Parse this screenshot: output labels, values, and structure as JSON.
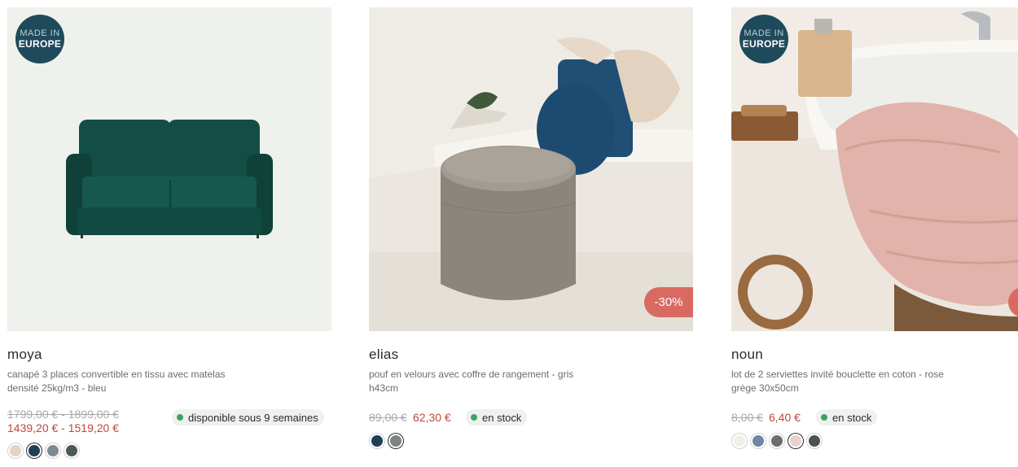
{
  "products": [
    {
      "badge": {
        "line1": "MADE IN",
        "line2": "EUROPE"
      },
      "name": "moya",
      "desc_lines": [
        "canapé 3 places convertible en tissu avec matelas",
        "densité 25kg/m3 - bleu"
      ],
      "price_old": "1799,00 € - 1899,00 €",
      "price_new": "1439,20 € - 1519,20 €",
      "stock": "disponible sous 9 semaines",
      "swatch_colors": [
        "#e2d4c0",
        "#1e3f55",
        "#7d8a92",
        "#4a5a52"
      ],
      "swatch_selected": 1
    },
    {
      "name": "elias",
      "discount": "-30%",
      "desc_lines": [
        "pouf en velours avec coffre de rangement - gris",
        "h43cm"
      ],
      "price_old": "89,00 €",
      "price_new": "62,30 €",
      "stock": "en stock",
      "swatch_colors": [
        "#1e3f55",
        "#7d8285"
      ],
      "swatch_selected": 1
    },
    {
      "badge": {
        "line1": "MADE IN",
        "line2": "EUROPE"
      },
      "name": "noun",
      "desc_lines": [
        "lot de 2 serviettes invité bouclette en coton - rose",
        "grège 30x50cm"
      ],
      "price_old": "8,00 €",
      "price_new": "6,40 €",
      "stock": "en stock",
      "swatch_colors": [
        "#f3f1e6",
        "#6f86a5",
        "#6b6e70",
        "#e7d3cb",
        "#4c524f"
      ],
      "swatch_selected": 3
    }
  ],
  "colors": {
    "accent_price": "#c0463c",
    "discount_bg": "#d96a62",
    "badge_bg": "#1f4a5c",
    "stock_dot": "#3ba55c"
  }
}
